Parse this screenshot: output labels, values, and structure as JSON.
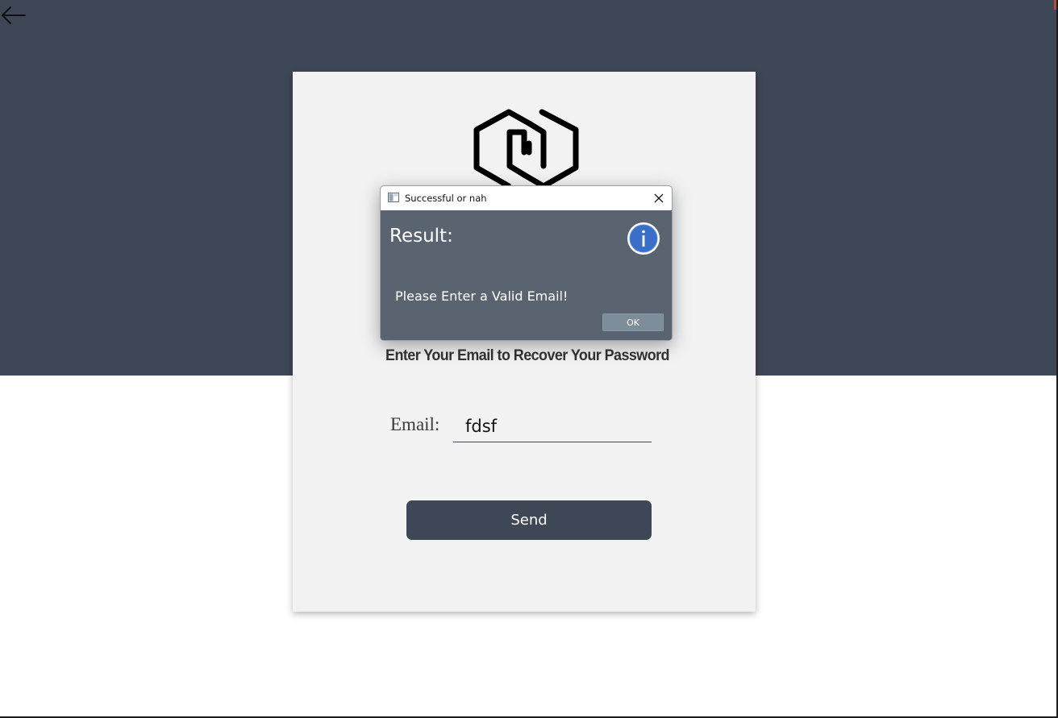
{
  "page": {
    "heading": "Enter Your Email to Recover Your Password",
    "email_label": "Email:",
    "email_value": "fdsf",
    "send_label": "Send"
  },
  "dialog": {
    "title": "Successful or nah",
    "heading": "Result:",
    "message": "Please Enter a Valid Email!",
    "ok_label": "OK"
  },
  "icons": {
    "back": "arrow-left-icon",
    "logo": "hexagon-logo",
    "dialog_app": "window-app-icon",
    "close": "close-icon",
    "info": "info-icon"
  },
  "colors": {
    "header_background": "#3e4756",
    "card_background": "#f2f2f2",
    "button_background": "#3e4756",
    "dialog_body": "#5a6470",
    "info_blue": "#3a6fc9",
    "ok_button": "#7d8d99"
  }
}
